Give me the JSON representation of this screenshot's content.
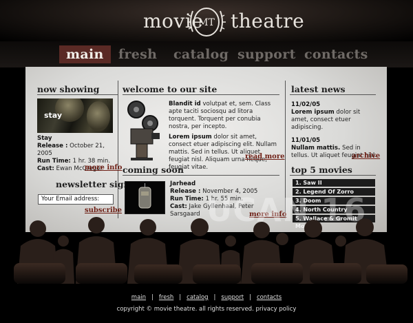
{
  "logo": {
    "word_left": "movie",
    "word_right": "theatre",
    "monogram": "MT"
  },
  "nav": [
    {
      "label": "main",
      "active": true
    },
    {
      "label": "fresh",
      "active": false
    },
    {
      "label": "catalog",
      "active": false
    },
    {
      "label": "support",
      "active": false
    },
    {
      "label": "contacts",
      "active": false
    }
  ],
  "now_showing": {
    "title": "now showing",
    "poster_text": "stay",
    "movie": "Stay",
    "release_label": "Release :",
    "release_value": "October 21, 2005",
    "runtime_label": "Run Time:",
    "runtime_value": "1 hr. 38 min.",
    "cast_label": "Cast:",
    "cast_value": "Ewan McGregor",
    "more_info": "more info"
  },
  "newsletter": {
    "title": "newsletter signup",
    "input_value": "Your Email address:",
    "subscribe": "subscribe"
  },
  "welcome": {
    "title": "welcome to our site",
    "p1_bold": "Blandit id",
    "p1_text": "volutpat et, sem. Class apte taciti sociosqu ad litora torquent. Torquent per conubia nostra, per incepto.",
    "p2_bold": "Lorem ipsum",
    "p2_text": "dolor sit amet, consect etuer adipiscing elit. Nullam mattis. Sed in tellus. Ut aliquet feugiat nisl. Aliquam urna neque, feugiat vitae.",
    "read_more": "read more"
  },
  "coming_soon": {
    "title": "coming soon",
    "movie": "Jarhead",
    "release_label": "Release :",
    "release_value": "November 4, 2005",
    "runtime_label": "Run Time:",
    "runtime_value": "1 hr. 55 min.",
    "cast_label": "Cast:",
    "cast_value": "Jake Gyllenhaal, Peter Sarsgaard",
    "more_info": "more info"
  },
  "latest_news": {
    "title": "latest news",
    "items": [
      {
        "date": "11/02/05",
        "bold": "Lorem ipsum",
        "text": "dolor sit amet, consect etuer adipiscing."
      },
      {
        "date": "11/01/05",
        "bold": "Nullam mattis.",
        "text": "Sed in tellus. Ut aliquet feugiat nisl."
      }
    ],
    "archive": "archive"
  },
  "top_movies": {
    "title": "top 5 movies",
    "items": [
      "1. Saw II",
      "2. Legend Of Zorro",
      "3. Doom",
      "4. North Country",
      "5. Wallace & Gromit Movie"
    ]
  },
  "watermark": "UCAN 16",
  "footer": {
    "links": [
      "main",
      "fresh",
      "catalog",
      "support",
      "contacts"
    ],
    "copyright": "copyright © movie theatre. all rights reserved. privacy policy"
  }
}
